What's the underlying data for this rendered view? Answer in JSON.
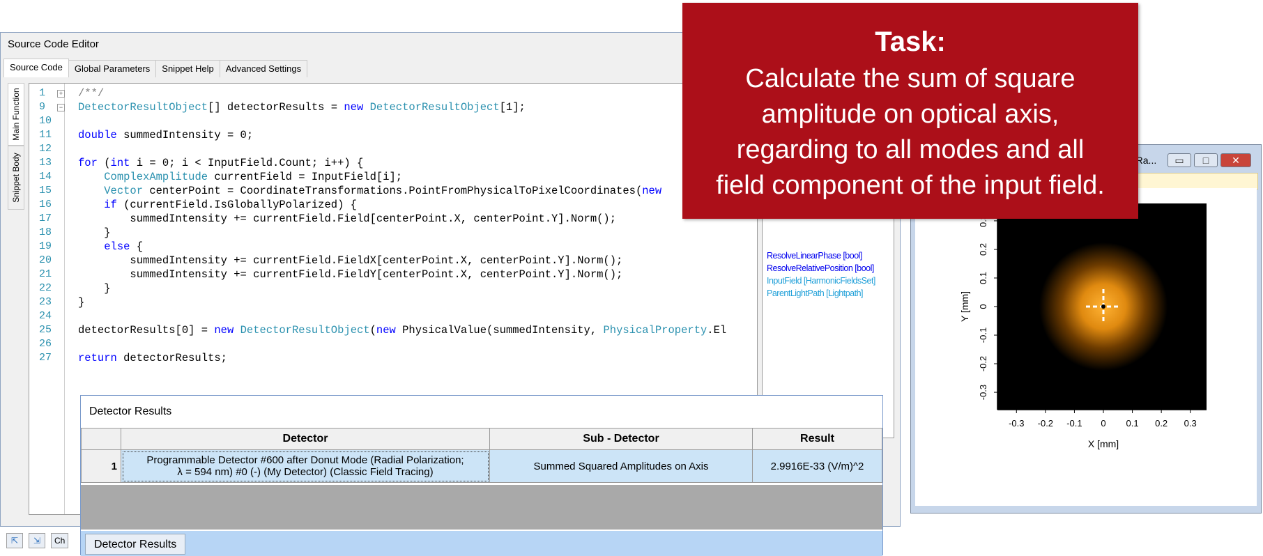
{
  "editor": {
    "title": "Source Code Editor",
    "tabs": [
      "Source Code",
      "Global Parameters",
      "Snippet Help",
      "Advanced Settings"
    ],
    "side_tabs": [
      "Main Function",
      "Snippet Body"
    ],
    "line_numbers": [
      "1",
      "9",
      "10",
      "11",
      "12",
      "13",
      "14",
      "15",
      "16",
      "17",
      "18",
      "19",
      "20",
      "21",
      "22",
      "23",
      "24",
      "25",
      "26",
      "27"
    ],
    "code_lines": [
      "/**/",
      "DetectorResultObject[] detectorResults = new DetectorResultObject[1];",
      "",
      "double summedIntensity = 0;",
      "",
      "for (int i = 0; i < InputField.Count; i++) {",
      "    ComplexAmplitude currentField = InputField[i];",
      "    Vector centerPoint = CoordinateTransformations.PointFromPhysicalToPixelCoordinates(new",
      "    if (currentField.IsGloballyPolarized) {",
      "        summedIntensity += currentField.Field[centerPoint.X, centerPoint.Y].Norm();",
      "    }",
      "    else {",
      "        summedIntensity += currentField.FieldX[centerPoint.X, centerPoint.Y].Norm();",
      "        summedIntensity += currentField.FieldY[centerPoint.X, centerPoint.Y].Norm();",
      "    }",
      "}",
      "",
      "detectorResults[0] = new DetectorResultObject(new PhysicalValue(summedIntensity, PhysicalProperty.El",
      "",
      "return detectorResults;"
    ],
    "snippet_items": [
      "ResolveLinearPhase [bool]",
      "ResolveRelativePosition [bool]",
      "InputField [HarmonicFieldsSet]",
      "ParentLightPath [Lightpath]"
    ],
    "bottom_label": "Ch"
  },
  "results": {
    "title": "Detector Results",
    "columns": [
      "Detector",
      "Sub - Detector",
      "Result"
    ],
    "rows": [
      {
        "index": "1",
        "detector_line1": "Programmable Detector #600 after Donut Mode (Radial Polarization;",
        "detector_line2": "λ = 594 nm) #0 (-) (My Detector) (Classic Field Tracing)",
        "sub_detector": "Summed Squared Amplitudes on Axis",
        "result": "2.9916E-33 (V/m)^2"
      }
    ],
    "tab_label": "Detector Results"
  },
  "plot": {
    "title": "(Ra...",
    "xlabel": "X [mm]",
    "ylabel": "Y [mm]",
    "x_ticks": [
      "-0.3",
      "-0.2",
      "-0.1",
      "0",
      "0.1",
      "0.2",
      "0.3"
    ],
    "y_ticks": [
      "0.3",
      "0.2",
      "0.1",
      "0",
      "-0.1",
      "-0.2",
      "-0.3"
    ],
    "colors": {
      "background": "#000000",
      "glow": "#f5a623"
    }
  },
  "task": {
    "title": "Task:",
    "lines": [
      "Calculate the sum of square",
      "amplitude on optical axis,",
      "regarding to all modes and all",
      "field component of the input field."
    ],
    "color": "#ac0f19"
  }
}
